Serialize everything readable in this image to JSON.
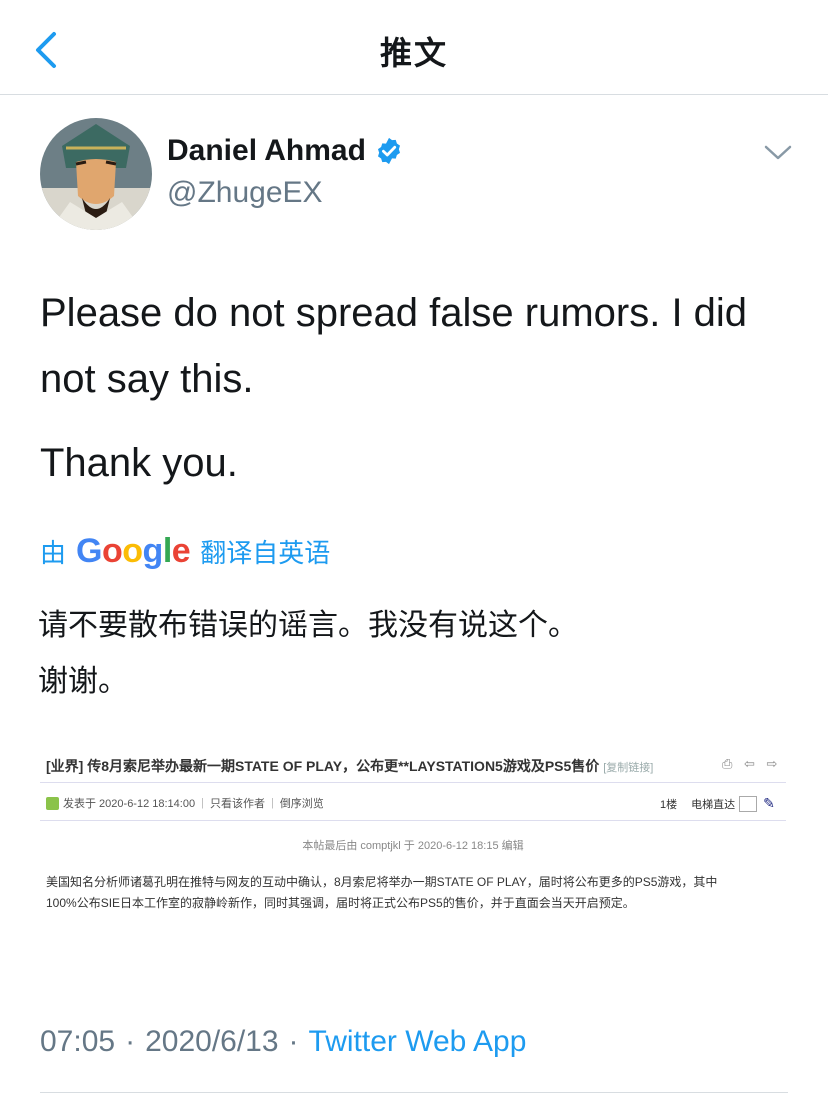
{
  "header": {
    "title": "推文"
  },
  "author": {
    "display_name": "Daniel Ahmad",
    "handle": "@ZhugeEX"
  },
  "tweet": {
    "paragraphs": [
      "Please do not spread false rumors. I did not say this.",
      "Thank you."
    ]
  },
  "translation": {
    "prefix": "由",
    "provider": "Google",
    "suffix": "翻译自英语",
    "paragraphs": [
      "请不要散布错误的谣言。我没有说这个。",
      "谢谢。"
    ]
  },
  "media": {
    "title": "[业界] 传8月索尼举办最新一期STATE OF PLAY，公布更**LAYSTATION5游戏及PS5售价",
    "copy_link": "[复制链接]",
    "tools": "⎙ ⇦ ⇨",
    "posted": "发表于 2020-6-12 18:14:00",
    "only_author": "只看该作者",
    "reverse": "倒序浏览",
    "floor": "1楼",
    "elevator": "电梯直达",
    "edited": "本帖最后由 comptjkl 于 2020-6-12 18:15 编辑",
    "body": [
      "美国知名分析师诸葛孔明在推特与网友的互动中确认，8月索尼将举办一期STATE OF PLAY，届时将公布更多的PS5游戏，其中",
      "100%公布SIE日本工作室的寂静岭新作，同时其强调，届时将正式公布PS5的售价，并于直面会当天开启预定。"
    ]
  },
  "footer": {
    "time": "07:05",
    "date": "2020/6/13",
    "separator": "·",
    "app": "Twitter Web App"
  },
  "colors": {
    "link": "#1d9bf0",
    "secondary": "#657786",
    "verified": "#1d9bf0"
  }
}
